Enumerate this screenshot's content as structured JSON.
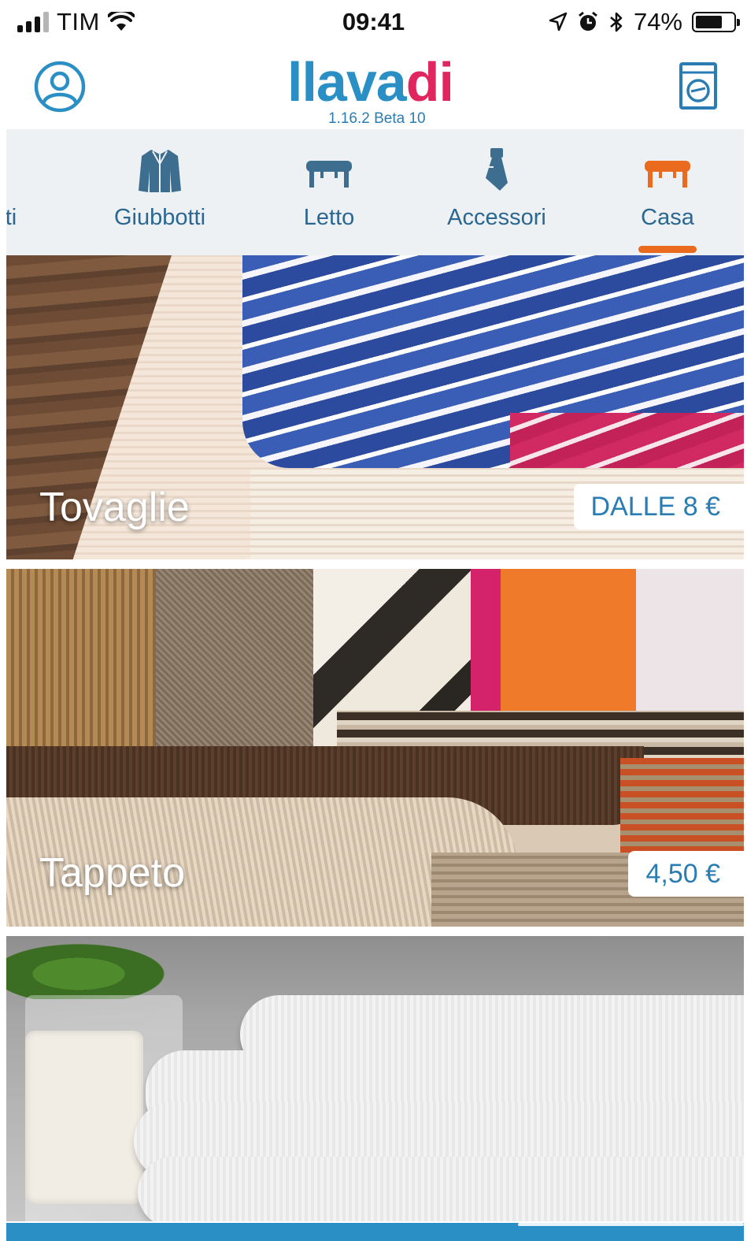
{
  "status_bar": {
    "carrier": "TIM",
    "time": "09:41",
    "battery_percent": "74%",
    "battery_level": 0.74,
    "icons": [
      "signal-icon",
      "wifi-icon",
      "location-icon",
      "alarm-icon",
      "bluetooth-icon",
      "battery-icon"
    ]
  },
  "header": {
    "logo_text_part1": "lava",
    "logo_text_part2": "di",
    "version": "1.16.2 Beta 10",
    "left_icon": "profile-icon",
    "right_icon": "washing-machine-icon",
    "colors": {
      "brand_blue": "#2a8fc4",
      "brand_pink": "#e0265f"
    }
  },
  "tabs": {
    "items": [
      {
        "label": "ti",
        "icon": ""
      },
      {
        "label": "Giubbotti",
        "icon": "jacket-icon"
      },
      {
        "label": "Letto",
        "icon": "bed-icon"
      },
      {
        "label": "Accessori",
        "icon": "tie-icon"
      },
      {
        "label": "Casa",
        "icon": "table-icon",
        "active": true
      }
    ],
    "colors": {
      "icon": "#3e6e8f",
      "active_icon": "#ea6a1e",
      "label": "#2b6790",
      "indicator": "#ea6a1e"
    }
  },
  "cards": [
    {
      "title": "Tovaglie",
      "price": "DALLE 8 €"
    },
    {
      "title": "Tappeto",
      "price": "4,50 €"
    },
    {
      "title": "",
      "price": ""
    }
  ]
}
